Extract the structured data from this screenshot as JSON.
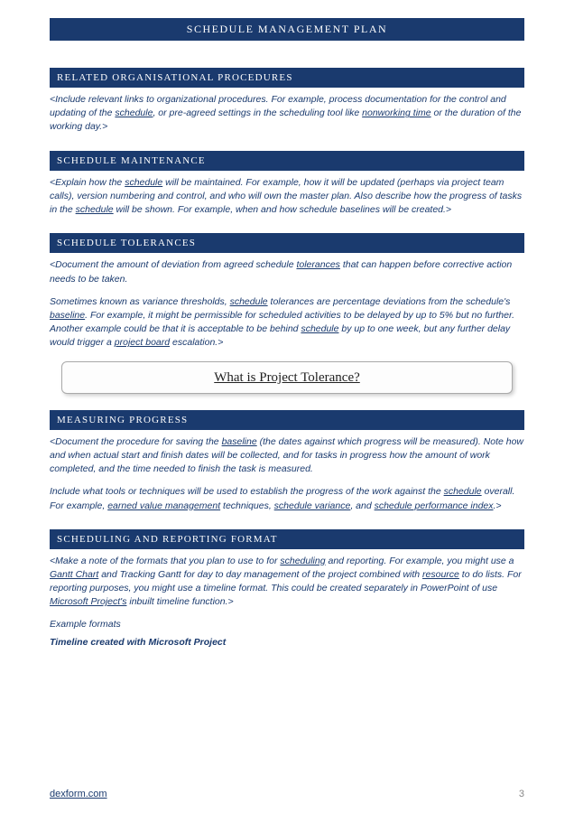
{
  "banner": "SCHEDULE MANAGEMENT PLAN",
  "sections": {
    "related": {
      "title": "RELATED ORGANISATIONAL PROCEDURES",
      "p1a": "<Include relevant links to organizational procedures. For example, process documentation for the control and updating of the ",
      "link1": "schedule",
      "p1b": ", or pre-agreed settings in the scheduling tool like ",
      "link2": "nonworking time",
      "p1c": " or the duration of the working day.>"
    },
    "maintenance": {
      "title": "SCHEDULE MAINTENANCE",
      "p1a": "<Explain how the ",
      "link1": "schedule",
      "p1b": " will be maintained. For example, how it will be updated (perhaps via project team calls), version numbering and control, and who will own the master plan. Also describe how the progress of tasks in the ",
      "link2": "schedule",
      "p1c": " will be shown. For example, when and how schedule baselines will be created.>"
    },
    "tolerances": {
      "title": "SCHEDULE TOLERANCES",
      "p1a": "<Document the amount of deviation from agreed schedule ",
      "link1": "tolerances",
      "p1b": " that can happen before corrective action needs to be taken.",
      "p2a": "Sometimes known as variance thresholds, ",
      "link2": "schedule",
      "p2b": " tolerances are percentage deviations from the schedule's ",
      "link3": "baseline",
      "p2c": ". For example, it might be permissible for scheduled activities to be delayed by up to 5% but no further. Another example could be that it is acceptable to be behind ",
      "link4": "schedule",
      "p2d": " by up to one week, but any further delay would trigger a ",
      "link5": "project board",
      "p2e": " escalation.>",
      "callout": "What is Project Tolerance?"
    },
    "measuring": {
      "title": "MEASURING PROGRESS",
      "p1a": "<Document the procedure for saving the ",
      "link1": "baseline",
      "p1b": " (the dates against which progress will be measured). Note how and when actual start and finish dates will be collected, and for tasks in progress how the amount of work completed, and the time needed to finish the task is measured.",
      "p2a": "Include what tools or techniques will be used to establish the progress of the work against the ",
      "link2": "schedule",
      "p2b": " overall. For example, ",
      "link3": "earned value management",
      "p2c": " techniques, ",
      "link4": "schedule variance",
      "p2d": ", and ",
      "link5": "schedule performance index",
      "p2e": ".>"
    },
    "format": {
      "title": "SCHEDULING AND REPORTING FORMAT",
      "p1a": "<Make a note of the formats that you plan to use to for ",
      "link1": "scheduling",
      "p1b": " and reporting. For example, you might use a ",
      "link2": "Gantt Chart",
      "p1c": " and Tracking Gantt for day to day management of the project combined with ",
      "link3": "resource",
      "p1d": " to do lists. For reporting purposes, you might use a timeline format. This could be created separately in PowerPoint of use ",
      "link4": "Microsoft Project's",
      "p1e": " inbuilt timeline function.>",
      "example_label": "Example formats",
      "timeline_label": "Timeline created with Microsoft Project"
    }
  },
  "footer": {
    "link": "dexform.com",
    "page": "3"
  }
}
